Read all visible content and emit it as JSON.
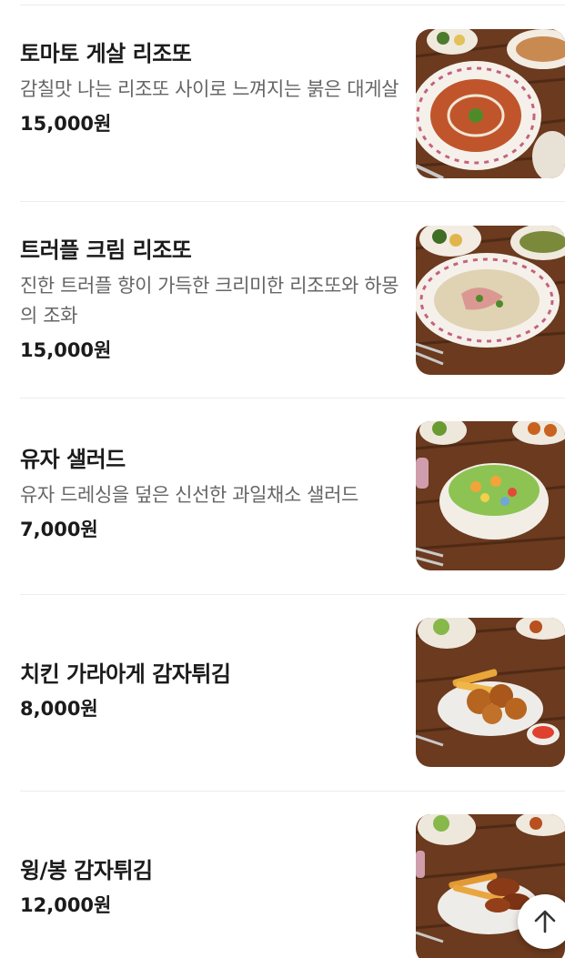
{
  "menu": {
    "items": [
      {
        "name": "토마토 게살 리조또",
        "description": "감칠맛 나는 리조또 사이로 느껴지는 붉은 대게살",
        "price": "15,000원",
        "image_icon": "food-photo-icon"
      },
      {
        "name": "트러플 크림 리조또",
        "description": "진한 트러플 향이 가득한 크리미한 리조또와 하몽의 조화",
        "price": "15,000원",
        "image_icon": "food-photo-icon"
      },
      {
        "name": "유자 샐러드",
        "description": "유자 드레싱을 덮은 신선한 과일채소 샐러드",
        "price": "7,000원",
        "image_icon": "food-photo-icon"
      },
      {
        "name": "치킨 가라아게 감자튀김",
        "price": "8,000원",
        "image_icon": "food-photo-icon"
      },
      {
        "name": "윙/봉 감자튀김",
        "price": "12,000원",
        "image_icon": "food-photo-icon"
      }
    ]
  },
  "scroll_top": {
    "icon": "arrow-up-icon"
  },
  "colors": {
    "title": "#1b1b1b",
    "description": "#666666",
    "divider": "#ececec",
    "table_wood": "#6b3a1f"
  }
}
